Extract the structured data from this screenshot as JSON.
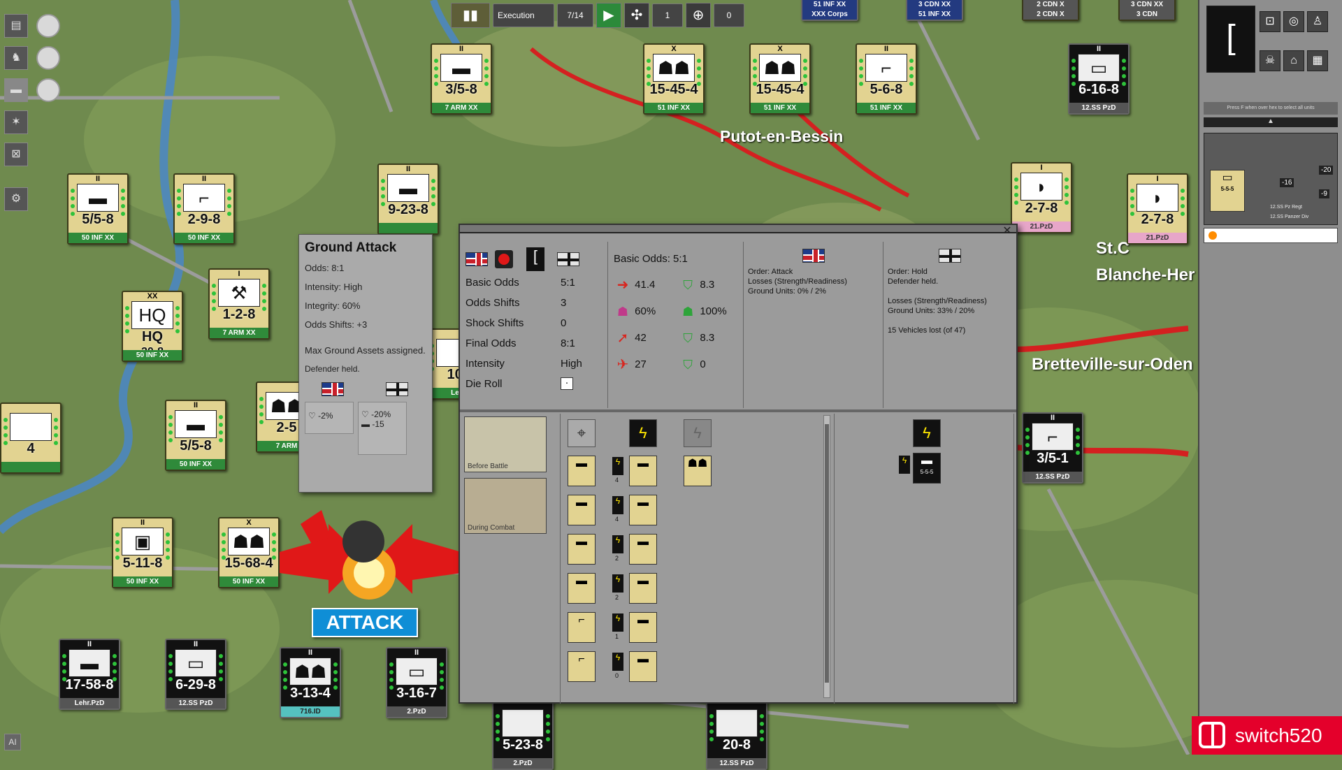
{
  "toolbar": {
    "phase": "Execution",
    "turn": "7/14",
    "counter_a": "1",
    "counter_b": "0"
  },
  "places": {
    "putot": "Putot-en-Bessin",
    "st_manvieu": "St.C",
    "blanche": "Blanche-Her",
    "bretteville": "Bretteville-sur-Oden"
  },
  "top_units": [
    {
      "formation": "51 INF XX"
    },
    {
      "formation": "XXX Corps"
    },
    {
      "formation": "3 CDN XX"
    },
    {
      "formation": "51 INF XX"
    },
    {
      "formation": "2 CDN X"
    },
    {
      "formation": "2 CDN X"
    },
    {
      "formation": "3 CDN XX"
    },
    {
      "formation": "3 CDN"
    }
  ],
  "units": [
    {
      "value": "3/5-8",
      "formation": "7 ARM XX",
      "size": "II",
      "icon": "tank"
    },
    {
      "value": "15-45-4",
      "formation": "51 INF XX",
      "size": "X",
      "icon": "infantry"
    },
    {
      "value": "15-45-4",
      "formation": "51 INF XX",
      "size": "X",
      "icon": "infantry"
    },
    {
      "value": "5-6-8",
      "formation": "51 INF XX",
      "size": "II",
      "icon": "at-gun"
    },
    {
      "value": "6-16-8",
      "formation": "12.SS PzD",
      "size": "II",
      "icon": "halftrack"
    },
    {
      "value": "5/5-8",
      "formation": "50 INF XX",
      "size": "II",
      "icon": "tank"
    },
    {
      "value": "2-9-8",
      "formation": "50 INF XX",
      "size": "II",
      "icon": "at-gun"
    },
    {
      "value": "9-23-8",
      "formation": "",
      "size": "II",
      "icon": "tank"
    },
    {
      "value": "2-7-8",
      "formation": "21.PzD",
      "size": "I",
      "icon": "armored-car"
    },
    {
      "value": "2-7-8",
      "formation": "21.PzD",
      "size": "I",
      "icon": "armored-car"
    },
    {
      "value": "HQ",
      "formation": "50 INF XX",
      "size": "XX",
      "icon": "hq",
      "sub": "20-8"
    },
    {
      "value": "1-2-8",
      "formation": "7 ARM XX",
      "size": "I",
      "icon": "engineer"
    },
    {
      "value": "5/5-8",
      "formation": "50 INF XX",
      "size": "II",
      "icon": "tank"
    },
    {
      "value": "2-5",
      "formation": "7 ARM",
      "size": "",
      "icon": "infantry"
    },
    {
      "value": "3/5-1",
      "formation": "12.SS PzD",
      "size": "II",
      "icon": "at-gun"
    },
    {
      "value": "5-11-8",
      "formation": "50 INF XX",
      "size": "II",
      "icon": "mech"
    },
    {
      "value": "15-68-4",
      "formation": "50 INF XX",
      "size": "X",
      "icon": "infantry"
    },
    {
      "value": "17-58-8",
      "formation": "Lehr.PzD",
      "size": "II",
      "icon": "tank"
    },
    {
      "value": "6-29-8",
      "formation": "12.SS PzD",
      "size": "II",
      "icon": "halftrack"
    },
    {
      "value": "3-13-4",
      "formation": "716.ID",
      "size": "II",
      "icon": "infantry"
    },
    {
      "value": "3-16-7",
      "formation": "2.PzD",
      "size": "II",
      "icon": "halftrack"
    },
    {
      "value": "5-23-8",
      "formation": "2.PzD",
      "size": "",
      "icon": ""
    },
    {
      "value": "20-8",
      "formation": "12.SS PzD",
      "size": "",
      "icon": ""
    },
    {
      "value": "10-",
      "formation": "Leh",
      "size": "",
      "icon": ""
    },
    {
      "value": "4",
      "formation": "",
      "size": "",
      "icon": ""
    }
  ],
  "ground_attack": {
    "title": "Ground Attack",
    "odds": "Odds: 8:1",
    "intensity": "Intensity: High",
    "integrity": "Integrity: 60%",
    "odds_shifts": "Odds Shifts: +3",
    "note1": "Max Ground Assets assigned.",
    "note2": "Defender held.",
    "att_loss": "-2%",
    "def_loss": "-20%",
    "def_vehicles": "-15"
  },
  "combat": {
    "rows": [
      {
        "label": "Basic Odds",
        "value": "5:1"
      },
      {
        "label": "Odds Shifts",
        "value": "3"
      },
      {
        "label": "Shock Shifts",
        "value": "0"
      },
      {
        "label": "Final Odds",
        "value": "8:1"
      },
      {
        "label": "Intensity",
        "value": "High"
      },
      {
        "label": "Die Roll",
        "value": ""
      }
    ],
    "stats_title": "Basic Odds: 5:1",
    "att_stats": [
      "41.4",
      "60%",
      "42",
      "27"
    ],
    "def_stats": [
      "8.3",
      "100%",
      "8.3",
      "0"
    ],
    "att_order": "Order: Attack",
    "att_losses": "Losses (Strength/Readiness)",
    "att_ground": "Ground Units: 0% / 2%",
    "def_order": "Order: Hold",
    "def_held": "Defender held.",
    "def_losses": "Losses (Strength/Readiness)",
    "def_ground": "Ground Units: 33% / 20%",
    "def_vehicles": "15 Vehicles lost (of 47)",
    "thumb1": "Before Battle",
    "thumb2": "During Combat",
    "bars": [
      "4",
      "4",
      "2",
      "2",
      "1",
      "0"
    ]
  },
  "attack_label": "ATTACK",
  "right_panel": {
    "hint": "Press F when over hex to select all units",
    "unit": "5-5-5",
    "unit_form1": "12.SS Pz Regt",
    "unit_form2": "12.SS Panzer Div",
    "loss1": "-20",
    "loss2": "-16",
    "loss3": "-9"
  },
  "watermark": "switch520"
}
